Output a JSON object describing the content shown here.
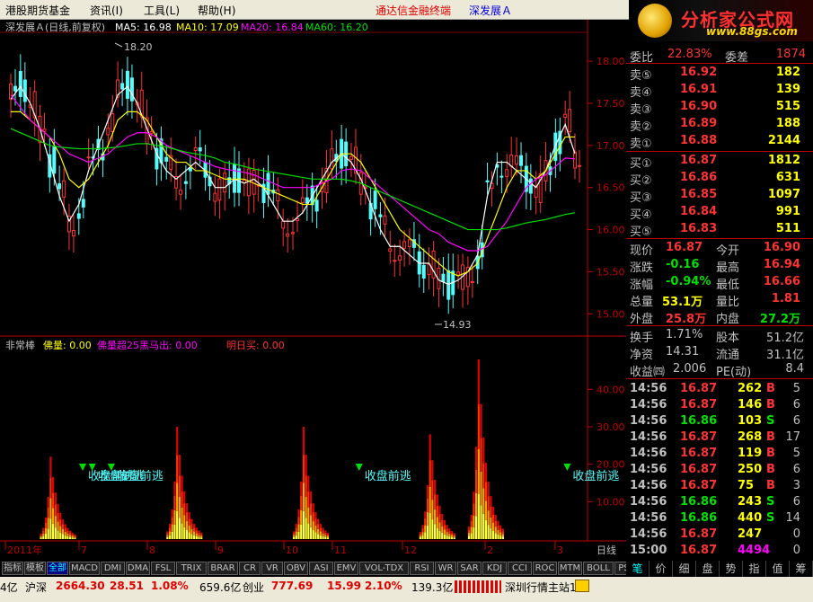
{
  "menu": {
    "items": [
      "港股期货基金",
      "资讯(I)",
      "工具(L)",
      "帮助(H)"
    ],
    "terminal_title": "通达信金融终端",
    "stock_title": "深发展Ａ"
  },
  "logo": {
    "text": "分析家公式网",
    "url": "www.88gs.com"
  },
  "chart": {
    "title": "深发展Ａ(日线,前复权)",
    "ma5": "MA5: 16.98",
    "ma10": "MA10: 17.09",
    "ma20": "MA20: 16.84",
    "ma60": "MA60: 16.20",
    "price_axis": [
      "18.00",
      "17.50",
      "17.00",
      "16.50",
      "16.00",
      "15.50",
      "15.00"
    ],
    "high_label": "18.20",
    "low_label": "14.93",
    "colors": {
      "up": "#ff3232",
      "down": "#54fcfc",
      "ma5": "#ffffff",
      "ma10": "#ffff00",
      "ma20": "#ff00ff",
      "ma60": "#00e000"
    }
  },
  "chart_data": {
    "type": "candlestick",
    "price_range": [
      14.8,
      18.3
    ],
    "ma5": [
      17.55,
      17.7,
      17.5,
      17.2,
      16.8,
      16.4,
      16.1,
      16.3,
      16.7,
      17.0,
      17.3,
      17.6,
      17.7,
      17.5,
      17.2,
      16.9,
      16.7,
      16.6,
      16.7,
      16.8,
      16.7,
      16.5,
      16.5,
      16.6,
      16.55,
      16.6,
      16.5,
      16.3,
      16.1,
      16.1,
      16.2,
      16.4,
      16.6,
      16.8,
      16.9,
      16.8,
      16.6,
      16.3,
      16.0,
      15.8,
      15.8,
      15.7,
      15.6,
      15.6,
      15.4,
      15.35,
      15.4,
      15.5,
      15.7,
      16.4,
      16.8,
      16.8,
      16.7,
      16.6,
      16.5,
      16.7,
      17.0,
      17.25,
      16.9
    ],
    "ma10": [
      17.4,
      17.4,
      17.3,
      17.2,
      17.1,
      16.9,
      16.6,
      16.5,
      16.6,
      16.8,
      17.0,
      17.3,
      17.4,
      17.4,
      17.3,
      17.1,
      16.9,
      16.8,
      16.8,
      16.7,
      16.7,
      16.65,
      16.6,
      16.6,
      16.6,
      16.55,
      16.5,
      16.45,
      16.4,
      16.35,
      16.3,
      16.3,
      16.5,
      16.7,
      16.9,
      16.9,
      16.8,
      16.6,
      16.4,
      16.2,
      16.0,
      15.9,
      15.8,
      15.7,
      15.6,
      15.5,
      15.45,
      15.5,
      15.6,
      15.9,
      16.2,
      16.5,
      16.7,
      16.7,
      16.6,
      16.7,
      16.9,
      17.1,
      17.1
    ],
    "ma20": [
      17.6,
      17.45,
      17.3,
      17.2,
      17.1,
      17.0,
      16.9,
      16.85,
      16.8,
      16.85,
      16.9,
      17.0,
      17.1,
      17.15,
      17.15,
      17.1,
      17.0,
      16.95,
      16.9,
      16.85,
      16.8,
      16.75,
      16.72,
      16.7,
      16.68,
      16.65,
      16.6,
      16.55,
      16.5,
      16.5,
      16.5,
      16.5,
      16.55,
      16.6,
      16.7,
      16.72,
      16.7,
      16.6,
      16.5,
      16.4,
      16.3,
      16.2,
      16.1,
      16.0,
      15.95,
      15.85,
      15.8,
      15.75,
      15.75,
      15.8,
      15.95,
      16.1,
      16.3,
      16.5,
      16.6,
      16.65,
      16.75,
      16.85,
      16.84
    ],
    "ma60": [
      17.2,
      17.15,
      17.1,
      17.05,
      17.0,
      16.98,
      16.97,
      16.96,
      16.96,
      16.96,
      16.97,
      16.98,
      17.0,
      17.02,
      17.02,
      17.0,
      16.98,
      16.95,
      16.92,
      16.9,
      16.88,
      16.85,
      16.8,
      16.78,
      16.75,
      16.72,
      16.7,
      16.68,
      16.66,
      16.64,
      16.62,
      16.6,
      16.6,
      16.6,
      16.6,
      16.58,
      16.55,
      16.5,
      16.45,
      16.4,
      16.35,
      16.3,
      16.25,
      16.2,
      16.15,
      16.1,
      16.05,
      16.0,
      16.0,
      16.0,
      16.0,
      16.02,
      16.05,
      16.08,
      16.1,
      16.12,
      16.15,
      16.18,
      16.2
    ],
    "indicator": {
      "name": "非常棒",
      "axis": [
        "40.00",
        "30.00",
        "20.00",
        "10.00"
      ],
      "range": [
        0,
        48
      ],
      "spikes": [
        {
          "center_index": 4,
          "peak": 22
        },
        {
          "center_index": 17,
          "peak": 30
        },
        {
          "center_index": 30,
          "peak": 30
        },
        {
          "center_index": 43,
          "peak": 28
        },
        {
          "center_index": 48,
          "peak": 48
        }
      ],
      "signals": [
        {
          "index": 7,
          "label": "收盘前逃"
        },
        {
          "index": 8,
          "label": "收盘前逃"
        },
        {
          "index": 10,
          "label": "收盘前逃"
        },
        {
          "index": 36,
          "label": "收盘前逃"
        },
        {
          "index": 55,
          "label": "收盘前逃"
        },
        {
          "index": 62,
          "label": "收盘前"
        }
      ]
    }
  },
  "indicator_header": {
    "name": "非常棒",
    "foliang": "佛量: 0.00",
    "foliang_super": "佛量超25黑马出: 0.00",
    "tomorrow": "明日买: 0.00"
  },
  "time_axis": [
    "2011年",
    "7",
    "8",
    "9",
    "10",
    "11",
    "12",
    "2",
    "3",
    "日线"
  ],
  "bottom_tabs": [
    "指标",
    "模板",
    "全部",
    "MACD",
    "DMI",
    "DMA",
    "FSL",
    "TRIX",
    "BRAR",
    "CR",
    "VR",
    "OBV",
    "ASI",
    "EMV",
    "VOL-TDX",
    "RSI",
    "WR",
    "SAR",
    "KDJ",
    "CCI",
    "ROC",
    "MTM",
    "BOLL",
    "PSY"
  ],
  "right_tabs": [
    "笔",
    "价",
    "细",
    "盘",
    "势",
    "指",
    "值",
    "筹"
  ],
  "quote": {
    "header": {
      "label1": "委比",
      "val1": "22.83%",
      "label2": "委差",
      "val2": "1874"
    },
    "sell": [
      {
        "label": "卖⑤",
        "price": "16.92",
        "vol": "182"
      },
      {
        "label": "卖④",
        "price": "16.91",
        "vol": "139"
      },
      {
        "label": "卖③",
        "price": "16.90",
        "vol": "515"
      },
      {
        "label": "卖②",
        "price": "16.89",
        "vol": "188"
      },
      {
        "label": "卖①",
        "price": "16.88",
        "vol": "2144"
      }
    ],
    "buy": [
      {
        "label": "买①",
        "price": "16.87",
        "vol": "1812"
      },
      {
        "label": "买②",
        "price": "16.86",
        "vol": "631"
      },
      {
        "label": "买③",
        "price": "16.85",
        "vol": "1097"
      },
      {
        "label": "买④",
        "price": "16.84",
        "vol": "991"
      },
      {
        "label": "买⑤",
        "price": "16.83",
        "vol": "511"
      }
    ],
    "stats": [
      {
        "l1": "现价",
        "v1": "16.87",
        "l2": "今开",
        "v2": "16.90"
      },
      {
        "l1": "涨跌",
        "v1": "-0.16",
        "l2": "最高",
        "v2": "16.94"
      },
      {
        "l1": "涨幅",
        "v1": "-0.94%",
        "l2": "最低",
        "v2": "16.66"
      },
      {
        "l1": "总量",
        "v1": "53.1万",
        "l2": "量比",
        "v2": "1.81"
      },
      {
        "l1": "外盘",
        "v1": "25.8万",
        "l2": "内盘",
        "v2": "27.2万"
      }
    ],
    "stats2": [
      {
        "l1": "换手",
        "v1": "1.71%",
        "l2": "股本",
        "v2": "51.2亿"
      },
      {
        "l1": "净资",
        "v1": "14.31",
        "l2": "流通",
        "v2": "31.1亿"
      },
      {
        "l1": "收益㈣",
        "v1": "2.006",
        "l2": "PE(动)",
        "v2": "8.4"
      }
    ],
    "ticks": [
      {
        "t": "14:56",
        "p": "16.87",
        "v": "262",
        "d": "B",
        "n": "5"
      },
      {
        "t": "14:56",
        "p": "16.87",
        "v": "146",
        "d": "B",
        "n": "6"
      },
      {
        "t": "14:56",
        "p": "16.86",
        "v": "103",
        "d": "S",
        "n": "6"
      },
      {
        "t": "14:56",
        "p": "16.87",
        "v": "268",
        "d": "B",
        "n": "17"
      },
      {
        "t": "14:56",
        "p": "16.87",
        "v": "119",
        "d": "B",
        "n": "5"
      },
      {
        "t": "14:56",
        "p": "16.87",
        "v": "250",
        "d": "B",
        "n": "6"
      },
      {
        "t": "14:56",
        "p": "16.87",
        "v": "75",
        "d": "B",
        "n": "3"
      },
      {
        "t": "14:56",
        "p": "16.86",
        "v": "243",
        "d": "S",
        "n": "6"
      },
      {
        "t": "14:56",
        "p": "16.86",
        "v": "440",
        "d": "S",
        "n": "14"
      },
      {
        "t": "14:56",
        "p": "16.87",
        "v": "247",
        "d": "",
        "n": "0"
      },
      {
        "t": "15:00",
        "p": "16.87",
        "v": "4494",
        "d": "",
        "n": "0"
      }
    ]
  },
  "status": {
    "prefix": "4亿",
    "sh_label": "沪深",
    "sh_val": "2664.30",
    "sh_chg": "28.51",
    "sh_pct": "1.08%",
    "sh_amt": "659.6亿",
    "cy_label": "创业",
    "cy_val": "777.69",
    "cy_chg": "15.99",
    "cy_pct": "2.10%",
    "cy_amt": "139.3亿",
    "server": "深圳行情主站1"
  }
}
